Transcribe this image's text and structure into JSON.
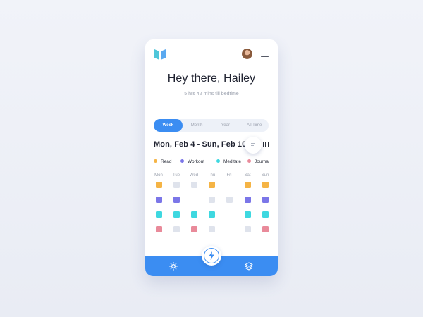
{
  "header": {
    "logo_icon": "book-icon",
    "avatar_icon": "user-avatar",
    "menu_icon": "hamburger-menu-icon"
  },
  "greeting": {
    "title": "Hey there, Hailey",
    "subtitle": "5 hrs 42 mins till bedtime"
  },
  "tabs": [
    {
      "label": "Week",
      "active": true
    },
    {
      "label": "Month",
      "active": false
    },
    {
      "label": "Year",
      "active": false
    },
    {
      "label": "All Time",
      "active": false
    }
  ],
  "date_range": "Mon, Feb 4 - Sun, Feb 10",
  "view_toggle": {
    "list_icon": "list-view-icon",
    "grid_icon": "grid-view-icon"
  },
  "legend": [
    {
      "label": "Read",
      "color": "#f5b445"
    },
    {
      "label": "Workout",
      "color": "#7b76e8"
    },
    {
      "label": "Meditate",
      "color": "#3ed8e0"
    },
    {
      "label": "Journal",
      "color": "#e98a9a"
    }
  ],
  "days": [
    "Mon",
    "Tue",
    "Wed",
    "Thu",
    "Fri",
    "Sat",
    "Sun"
  ],
  "tracker": {
    "empty_color": "#dfe3ec",
    "rows": [
      {
        "habit": "Read",
        "days": [
          "done",
          "empty",
          "empty",
          "done",
          "none",
          "done",
          "done"
        ]
      },
      {
        "habit": "Workout",
        "days": [
          "done",
          "done",
          "none",
          "empty",
          "empty",
          "done",
          "done"
        ]
      },
      {
        "habit": "Meditate",
        "days": [
          "done",
          "done",
          "done",
          "done",
          "none",
          "done",
          "done"
        ]
      },
      {
        "habit": "Journal",
        "days": [
          "done",
          "empty",
          "done",
          "empty",
          "none",
          "empty",
          "done"
        ]
      }
    ]
  },
  "bottom_nav": {
    "left_icon": "sun-icon",
    "center_icon": "lightning-icon",
    "right_icon": "layers-icon",
    "color": "#3b8df2"
  }
}
